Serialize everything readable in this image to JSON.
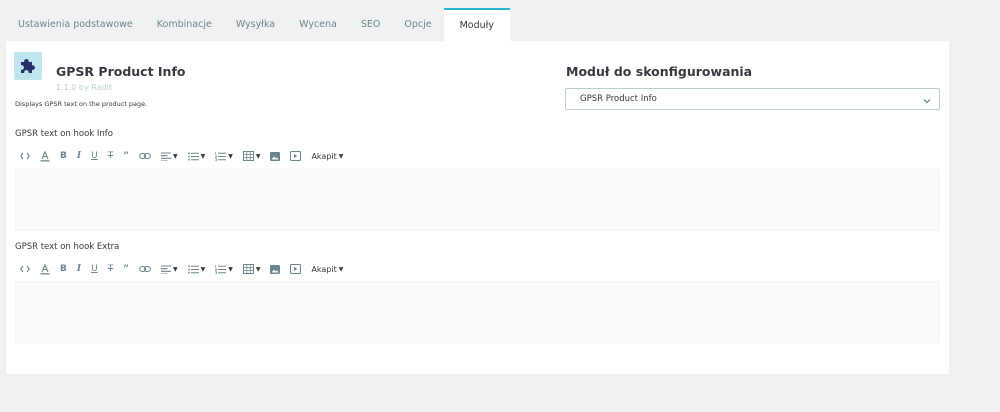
{
  "tabs": [
    {
      "label": "Ustawienia podstawowe"
    },
    {
      "label": "Kombinacje"
    },
    {
      "label": "Wysyłka"
    },
    {
      "label": "Wycena"
    },
    {
      "label": "SEO"
    },
    {
      "label": "Opcje"
    },
    {
      "label": "Moduły",
      "active": true
    }
  ],
  "module": {
    "icon": "puzzle-icon",
    "title": "GPSR Product Info",
    "version": "1.1.0 by Radit",
    "description": "Displays GPSR text on the product page."
  },
  "configure": {
    "heading": "Moduł do skonfigurowania",
    "selected": "GPSR Product Info"
  },
  "fields": [
    {
      "label": "GPSR text on hook Info",
      "content": ""
    },
    {
      "label": "GPSR text on hook Extra",
      "content": ""
    }
  ],
  "toolbar": {
    "buttons": [
      "code-view-icon",
      "font-color-icon",
      "bold-icon",
      "italic-icon",
      "underline-icon",
      "strikethrough-icon",
      "quote-icon",
      "link-icon",
      "align-icon",
      "bullet-list-icon",
      "numbered-list-icon",
      "table-icon",
      "image-icon",
      "media-icon"
    ],
    "paragraph_label": "Akapit"
  },
  "colors": {
    "accent": "#25b9d7",
    "icon_bg": "#bfe6ee",
    "icon_fg": "#25306a",
    "muted": "#bbcdd2",
    "text": "#363a41"
  }
}
